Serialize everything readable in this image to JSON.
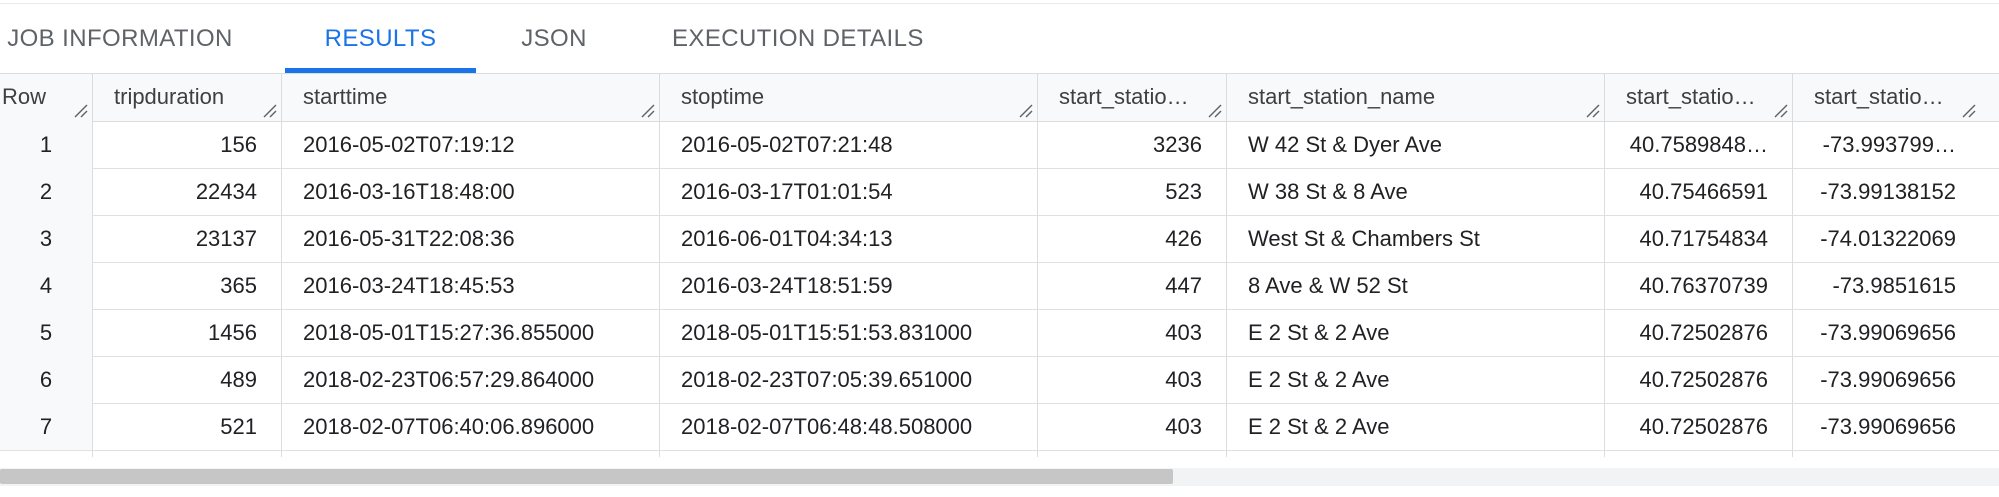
{
  "tabs": [
    {
      "label": "JOB INFORMATION"
    },
    {
      "label": "RESULTS"
    },
    {
      "label": "JSON"
    },
    {
      "label": "EXECUTION DETAILS"
    }
  ],
  "table": {
    "columns": [
      "Row",
      "tripduration",
      "starttime",
      "stoptime",
      "start_statio…",
      "start_station_name",
      "start_statio…",
      "start_statio…"
    ],
    "rows": [
      [
        "1",
        "156",
        "2016-05-02T07:19:12",
        "2016-05-02T07:21:48",
        "3236",
        "W 42 St & Dyer Ave",
        "40.7589848…",
        "-73.993799…"
      ],
      [
        "2",
        "22434",
        "2016-03-16T18:48:00",
        "2016-03-17T01:01:54",
        "523",
        "W 38 St & 8 Ave",
        "40.75466591",
        "-73.99138152"
      ],
      [
        "3",
        "23137",
        "2016-05-31T22:08:36",
        "2016-06-01T04:34:13",
        "426",
        "West St & Chambers St",
        "40.71754834",
        "-74.01322069"
      ],
      [
        "4",
        "365",
        "2016-03-24T18:45:53",
        "2016-03-24T18:51:59",
        "447",
        "8 Ave & W 52 St",
        "40.76370739",
        "-73.9851615"
      ],
      [
        "5",
        "1456",
        "2018-05-01T15:27:36.855000",
        "2018-05-01T15:51:53.831000",
        "403",
        "E 2 St & 2 Ave",
        "40.72502876",
        "-73.99069656"
      ],
      [
        "6",
        "489",
        "2018-02-23T06:57:29.864000",
        "2018-02-23T07:05:39.651000",
        "403",
        "E 2 St & 2 Ave",
        "40.72502876",
        "-73.99069656"
      ],
      [
        "7",
        "521",
        "2018-02-07T06:40:06.896000",
        "2018-02-07T06:48:48.508000",
        "403",
        "E 2 St & 2 Ave",
        "40.72502876",
        "-73.99069656"
      ]
    ]
  },
  "colors": {
    "accent": "#1a73e8",
    "header_bg": "#f8f9fa",
    "border": "#dadce0"
  },
  "active_tab": "RESULTS"
}
